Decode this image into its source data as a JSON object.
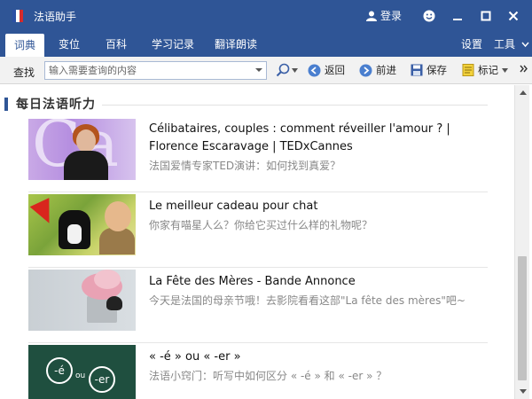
{
  "app": {
    "title": "法语助手",
    "login_label": "登录"
  },
  "tabs": [
    {
      "label": "词典",
      "active": true
    },
    {
      "label": "变位",
      "active": false
    },
    {
      "label": "百科",
      "active": false
    },
    {
      "label": "学习记录",
      "active": false
    },
    {
      "label": "翻译朗读",
      "active": false
    }
  ],
  "tabs_right": {
    "settings": "设置",
    "tools": "工具"
  },
  "toolbar": {
    "search_label": "查找",
    "search_placeholder": "输入需要查询的内容",
    "back": "返回",
    "forward": "前进",
    "save": "保存",
    "bookmark": "标记"
  },
  "section": {
    "title": "每日法语听力"
  },
  "items": [
    {
      "title": "Célibataires, couples : comment réveiller l'amour ? | Florence Escaravage | TEDxCannes",
      "subtitle": "法国爱情专家TED演讲：如何找到真爱？",
      "thumb_text": [
        "Ca"
      ]
    },
    {
      "title": "Le meilleur cadeau pour chat",
      "subtitle": "你家有喵星人么？你给它买过什么样的礼物呢？"
    },
    {
      "title": "La Fête des Mères - Bande Annonce",
      "subtitle": "今天是法国的母亲节哦！去影院看看这部\"La fête des mères\"吧~"
    },
    {
      "title": "« -é » ou « -er »",
      "subtitle": "法语小窍门：听写中如何区分 « -é » 和 « -er » ？",
      "thumb_text": [
        "-é",
        "ou",
        "-er"
      ]
    }
  ],
  "colors": {
    "brand": "#2f5596",
    "toolbar_bg": "#f2f2f2"
  }
}
